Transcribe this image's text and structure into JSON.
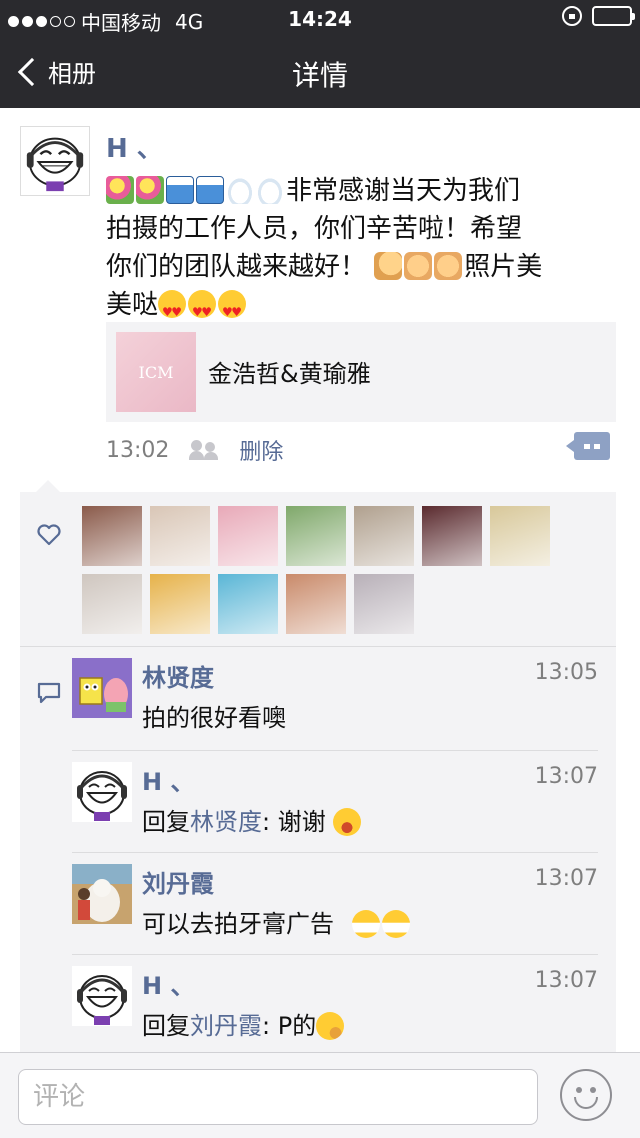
{
  "status_bar": {
    "carrier": "中国移动",
    "network": "4G",
    "time": "14:24",
    "signal_bars_filled": 3,
    "signal_bars_total": 5
  },
  "nav": {
    "back_label": "相册",
    "title": "详情"
  },
  "post": {
    "author": "H 、",
    "text_lines": [
      "非常感谢当天为我们",
      "拍摄的工作人员，你们辛苦啦！希望",
      "你们的团队越来越好！",
      "照片美",
      "美哒"
    ],
    "emoji": [
      "tulip",
      "tulip",
      "wave",
      "wave",
      "cloud",
      "cloud",
      "muscle",
      "clap",
      "clap",
      "heart-eyes",
      "heart-eyes",
      "heart-eyes"
    ],
    "link_card": {
      "title": "金浩哲&黄瑜雅",
      "thumb_text": "ICM"
    },
    "time": "13:02",
    "delete_label": "删除"
  },
  "likes": {
    "count": 12,
    "avatar_colors": [
      "#8a5a4a",
      "#d9c6b6",
      "#e8a9b8",
      "#7fa86a",
      "#b0a08e",
      "#5a2a2e",
      "#d8c89a",
      "#cfc6bf",
      "#e6b24a",
      "#5ab6d6",
      "#c98a6a",
      "#b8b0b8"
    ]
  },
  "comments": [
    {
      "name": "林贤度",
      "time": "13:05",
      "text": "拍的很好看噢",
      "reply_to": "",
      "prefix": "",
      "sep": "",
      "emoji": ""
    },
    {
      "name": "H 、",
      "time": "13:07",
      "text": "谢谢",
      "reply_to": "林贤度",
      "prefix": "回复",
      "sep": ": ",
      "emoji": "smile"
    },
    {
      "name": "刘丹霞",
      "time": "13:07",
      "text": "可以去拍牙膏广告",
      "reply_to": "",
      "prefix": "",
      "sep": "",
      "emoji": "grin"
    },
    {
      "name": "H 、",
      "time": "13:07",
      "text": "P的",
      "reply_to": "刘丹霞",
      "prefix": "回复",
      "sep": ": ",
      "emoji": "think"
    }
  ],
  "input": {
    "placeholder": "评论"
  },
  "colors": {
    "nav_bg": "#2a2a2e",
    "link_blue": "#576b95",
    "panel_bg": "#f3f3f5"
  }
}
